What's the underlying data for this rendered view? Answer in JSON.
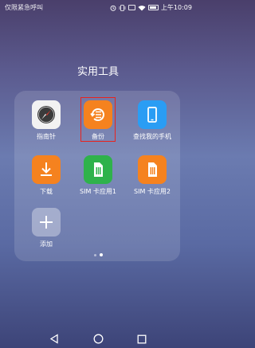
{
  "status_bar": {
    "carrier_text": "仅限紧急呼叫",
    "time": "上午10:09",
    "icons": [
      "alarm-icon",
      "vibrate-icon",
      "signal-icon",
      "wifi-icon",
      "battery-icon"
    ]
  },
  "folder": {
    "title": "实用工具",
    "apps": [
      {
        "label": "指南针",
        "icon": "compass-icon",
        "color": "#f2f2f2"
      },
      {
        "label": "备份",
        "icon": "backup-icon",
        "color": "#f5821f",
        "highlighted": true
      },
      {
        "label": "查找我的手机",
        "icon": "find-phone-icon",
        "color": "#2a9df4"
      },
      {
        "label": "下载",
        "icon": "download-icon",
        "color": "#f5821f"
      },
      {
        "label": "SIM 卡应用1",
        "icon": "sim-icon",
        "color": "#2fb24b"
      },
      {
        "label": "SIM 卡应用2",
        "icon": "sim-icon",
        "color": "#f5821f"
      },
      {
        "label": "添加",
        "icon": "add-icon",
        "color": "#8a8fb0"
      }
    ],
    "page_indicator": {
      "pages": 2,
      "current": 2
    }
  },
  "nav_bar": {
    "buttons": [
      "back-icon",
      "home-icon",
      "recents-icon"
    ]
  },
  "colors": {
    "highlight_box": "#e8231e"
  }
}
